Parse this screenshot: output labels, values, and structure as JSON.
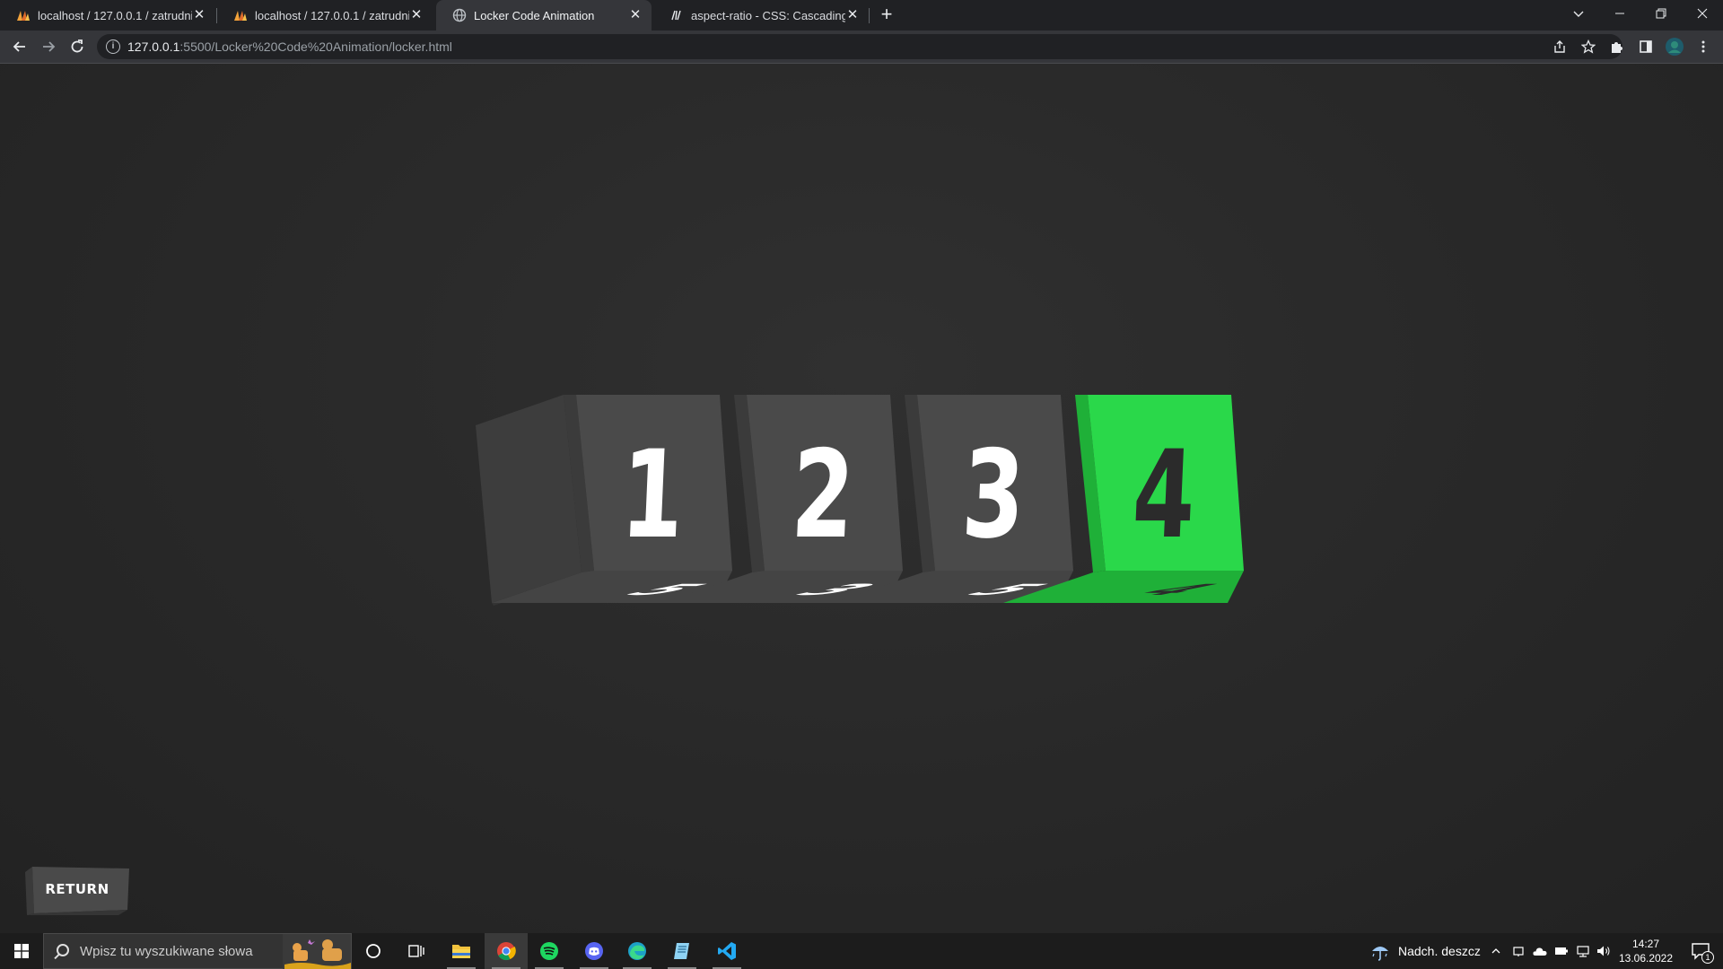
{
  "browser": {
    "tabs": [
      {
        "title": "localhost / 127.0.0.1 / zatrudnienie",
        "favicon": "phpmyadmin-icon",
        "active": false
      },
      {
        "title": "localhost / 127.0.0.1 / zatrudnienie",
        "favicon": "phpmyadmin-icon",
        "active": false
      },
      {
        "title": "Locker Code Animation",
        "favicon": "globe-icon",
        "active": true
      },
      {
        "title": "aspect-ratio - CSS: Cascading Style Sheets",
        "favicon": "mdn-icon",
        "active": false
      }
    ],
    "close_glyph": "✕",
    "new_tab_glyph": "+",
    "address": {
      "host": "127.0.0.1",
      "path": ":5500/Locker%20Code%20Animation/locker.html"
    },
    "colors": {
      "frame": "#202124",
      "toolbar": "#35363a",
      "omnibox": "#202124"
    }
  },
  "locker": {
    "digits": [
      {
        "current": "1",
        "next": "5",
        "unlocked": false
      },
      {
        "current": "2",
        "next": "3",
        "unlocked": false
      },
      {
        "current": "3",
        "next": "5",
        "unlocked": false
      },
      {
        "current": "4",
        "next": "4",
        "unlocked": true
      }
    ],
    "return_label": "RETURN",
    "colors": {
      "face": "#4a4a4a",
      "face_dark": "#3b3b3b",
      "bottom": "#444444",
      "green": "#2ad84a",
      "green_dark": "#1fb038",
      "digit_light": "#ffffff",
      "digit_dark": "#2b2b2b"
    }
  },
  "taskbar": {
    "search_placeholder": "Wpisz tu wyszukiwane słowa",
    "apps": [
      "cortana-icon",
      "task-view-icon",
      "file-explorer-icon",
      "chrome-icon",
      "spotify-icon",
      "discord-icon",
      "edge-icon",
      "notepad-icon",
      "vscode-icon"
    ],
    "weather": "Nadch. deszcz",
    "time": "14:27",
    "date": "13.06.2022",
    "notification_count": "1"
  }
}
